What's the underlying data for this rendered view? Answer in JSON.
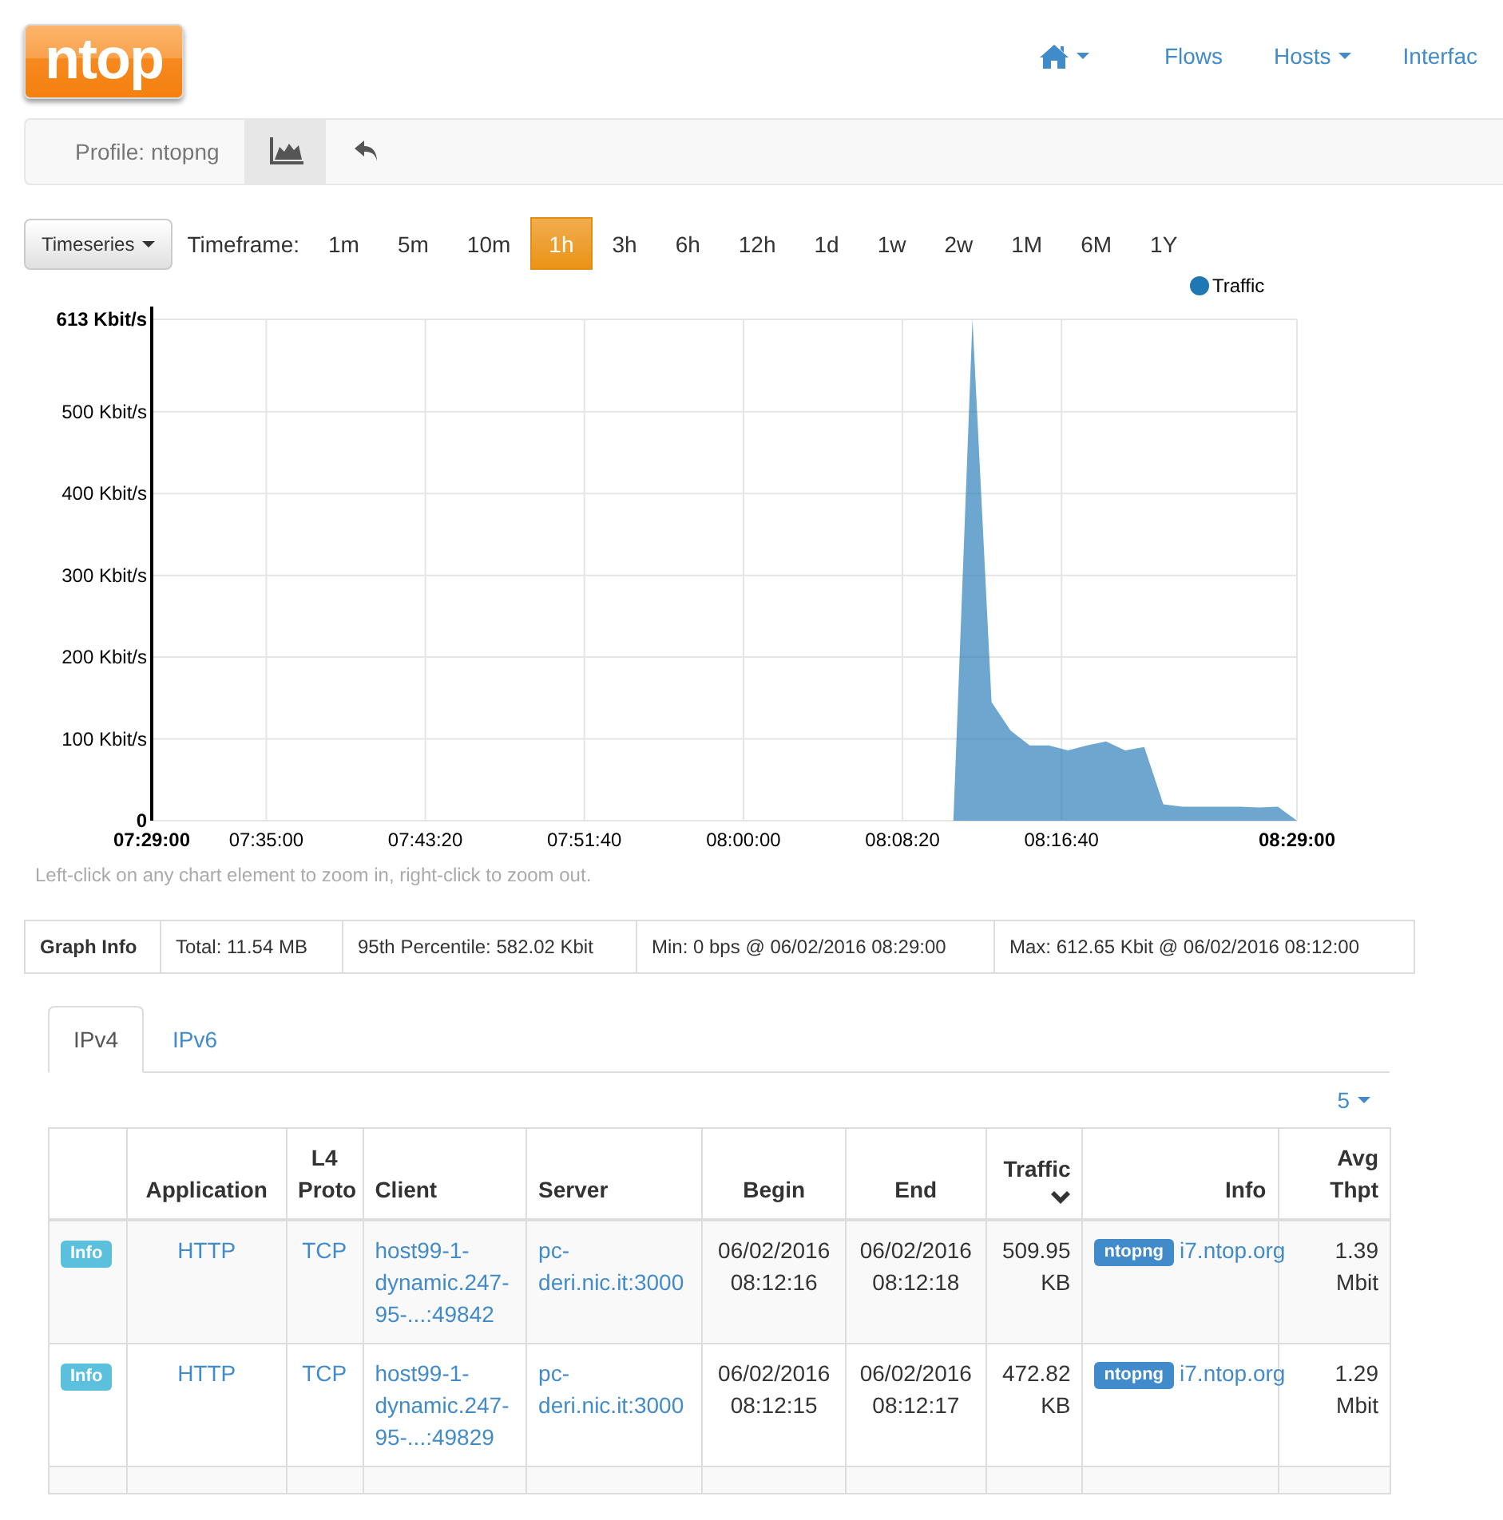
{
  "header": {
    "logo": "ntop",
    "nav": [
      {
        "kind": "home"
      },
      {
        "kind": "link",
        "label": "Flows"
      },
      {
        "kind": "dropdown",
        "label": "Hosts"
      },
      {
        "kind": "link",
        "label": "Interfac"
      }
    ]
  },
  "profile_bar": {
    "label": "Profile: ntopng",
    "buttons": [
      {
        "kind": "chart",
        "selected": true
      },
      {
        "kind": "undo",
        "selected": false
      }
    ]
  },
  "timeframe_bar": {
    "menu": "Timeseries",
    "label": "Timeframe:",
    "options": [
      {
        "label": "1m",
        "selected": false
      },
      {
        "label": "5m",
        "selected": false
      },
      {
        "label": "10m",
        "selected": false
      },
      {
        "label": "1h",
        "selected": true
      },
      {
        "label": "3h",
        "selected": false
      },
      {
        "label": "6h",
        "selected": false
      },
      {
        "label": "12h",
        "selected": false
      },
      {
        "label": "1d",
        "selected": false
      },
      {
        "label": "1w",
        "selected": false
      },
      {
        "label": "2w",
        "selected": false
      },
      {
        "label": "1M",
        "selected": false
      },
      {
        "label": "6M",
        "selected": false
      },
      {
        "label": "1Y",
        "selected": false
      }
    ]
  },
  "chart": {
    "chart_data": {
      "type": "area",
      "grid": true,
      "xlim": [
        26940,
        30540
      ],
      "ylim": [
        0,
        613
      ],
      "x": [
        29460,
        29520,
        29580,
        29640,
        29700,
        29760,
        29820,
        29880,
        29940,
        30000,
        30060,
        30120,
        30180,
        30240,
        30300,
        30360,
        30420,
        30480,
        30540
      ],
      "series": [
        {
          "name": "Traffic",
          "color": "#1f77b4",
          "values": [
            0,
            613,
            145,
            110,
            92,
            92,
            86,
            92,
            97,
            86,
            90,
            20,
            17,
            17,
            17,
            17,
            16,
            17,
            0
          ]
        }
      ],
      "xticks": [
        {
          "value": 26940,
          "label": "07:29:00"
        },
        {
          "value": 27300,
          "label": "07:35:00"
        },
        {
          "value": 27800,
          "label": "07:43:20"
        },
        {
          "value": 28300,
          "label": "07:51:40"
        },
        {
          "value": 28800,
          "label": "08:00:00"
        },
        {
          "value": 29300,
          "label": "08:08:20"
        },
        {
          "value": 29800,
          "label": "08:16:40"
        },
        {
          "value": 30540,
          "label": "08:29:00"
        }
      ],
      "yticks": [
        {
          "value": 0,
          "label": "0"
        },
        {
          "value": 100,
          "label": "100 Kbit/s"
        },
        {
          "value": 200,
          "label": "200 Kbit/s"
        },
        {
          "value": 300,
          "label": "300 Kbit/s"
        },
        {
          "value": 400,
          "label": "400 Kbit/s"
        },
        {
          "value": 500,
          "label": "500 Kbit/s"
        },
        {
          "value": 613,
          "label": "613 Kbit/s"
        }
      ]
    },
    "hint": "Left-click on any chart element to zoom in, right-click to zoom out."
  },
  "graph_info": {
    "label": "Graph Info",
    "cells": [
      "Total: 11.54 MB",
      "95th Percentile: 582.02 Kbit",
      "Min: 0 bps @ 06/02/2016 08:29:00",
      "Max: 612.65 Kbit @ 06/02/2016 08:12:00"
    ]
  },
  "tabs": [
    {
      "label": "IPv4",
      "selected": true
    },
    {
      "label": "IPv6",
      "selected": false
    }
  ],
  "page_size": "5",
  "table": {
    "columns": [
      {
        "label": "Application",
        "sorted": false
      },
      {
        "label": "L4 Proto",
        "sorted": false
      },
      {
        "label": "Client",
        "sorted": false
      },
      {
        "label": "Server",
        "sorted": false
      },
      {
        "label": "Begin",
        "sorted": false
      },
      {
        "label": "End",
        "sorted": false
      },
      {
        "label": "Traffic",
        "sorted": true
      },
      {
        "label": "Info",
        "sorted": false
      },
      {
        "label": "Avg Thpt",
        "sorted": false
      }
    ],
    "rows": [
      {
        "badge": "Info",
        "application": "HTTP",
        "proto": "TCP",
        "client": "host99-1-dynamic.247-95-...:49842",
        "server": "pc-deri.nic.it:3000",
        "begin": "06/02/2016 08:12:16",
        "end": "06/02/2016 08:12:18",
        "traffic": "509.95 KB",
        "info_tag": "ntopng",
        "info_link": "i7.ntop.org",
        "throughput": "1.39 Mbit"
      },
      {
        "badge": "Info",
        "application": "HTTP",
        "proto": "TCP",
        "client": "host99-1-dynamic.247-95-...:49829",
        "server": "pc-deri.nic.it:3000",
        "begin": "06/02/2016 08:12:15",
        "end": "06/02/2016 08:12:17",
        "traffic": "472.82 KB",
        "info_tag": "ntopng",
        "info_link": "i7.ntop.org",
        "throughput": "1.29 Mbit"
      }
    ]
  }
}
